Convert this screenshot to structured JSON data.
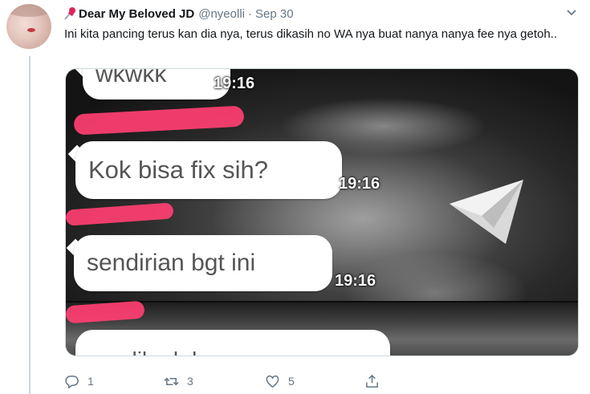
{
  "tweet": {
    "display_name": "Dear My Beloved JD",
    "name_prefix_icon": "pushpin-icon",
    "handle": "@nyeolli",
    "separator": "·",
    "date": "Sep 30",
    "text": "Ini kita pancing terus kan dia nya, terus dikasih no WA nya buat nanya nanya fee nya getoh..",
    "menu_icon": "chevron-down-icon"
  },
  "media": {
    "messages": [
      {
        "text": "wkwkk",
        "time": "19:16"
      },
      {
        "text": "Kok bisa fix sih?",
        "time": "19:16"
      },
      {
        "text": "sendirian bgt ini",
        "time": "19:16"
      },
      {
        "text": "...n..lih ..b.k.."
      }
    ]
  },
  "actions": {
    "reply": {
      "icon": "reply-icon",
      "count": "1"
    },
    "retweet": {
      "icon": "retweet-icon",
      "count": "3"
    },
    "like": {
      "icon": "heart-icon",
      "count": "5"
    },
    "share": {
      "icon": "share-icon"
    }
  },
  "colors": {
    "text_primary": "#14171a",
    "text_secondary": "#657786",
    "redaction": "#ff3f72",
    "thread_line": "#ccd6dd"
  }
}
